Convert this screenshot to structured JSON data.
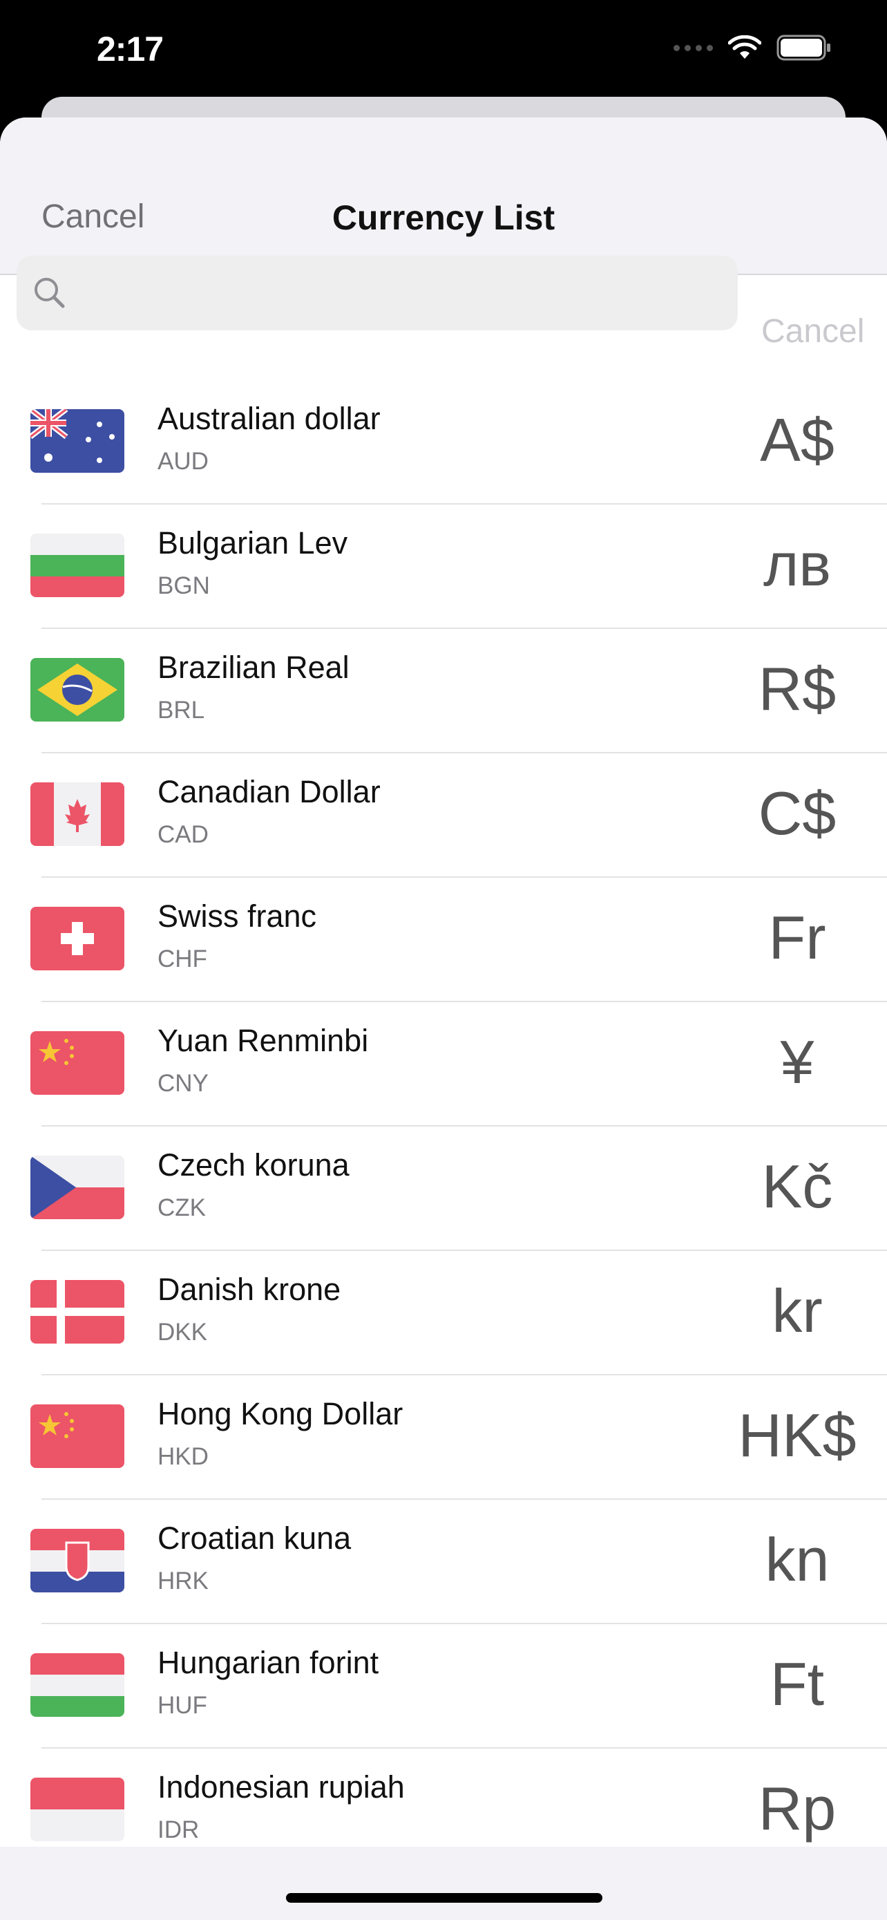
{
  "status_bar": {
    "time": "2:17"
  },
  "nav": {
    "cancel_label": "Cancel",
    "title": "Currency List"
  },
  "search": {
    "placeholder": "",
    "value": "",
    "cancel_label": "Cancel"
  },
  "currencies": [
    {
      "name": "Australian dollar",
      "code": "AUD",
      "symbol": "A$",
      "flag": "australia"
    },
    {
      "name": "Bulgarian Lev",
      "code": "BGN",
      "symbol": "лв",
      "flag": "bulgaria"
    },
    {
      "name": "Brazilian Real",
      "code": "BRL",
      "symbol": "R$",
      "flag": "brazil"
    },
    {
      "name": "Canadian Dollar",
      "code": "CAD",
      "symbol": "C$",
      "flag": "canada"
    },
    {
      "name": "Swiss franc",
      "code": "CHF",
      "symbol": "Fr",
      "flag": "switzerland"
    },
    {
      "name": "Yuan Renminbi",
      "code": "CNY",
      "symbol": "¥",
      "flag": "china"
    },
    {
      "name": "Czech koruna",
      "code": "CZK",
      "symbol": "Kč",
      "flag": "czech"
    },
    {
      "name": "Danish krone",
      "code": "DKK",
      "symbol": "kr",
      "flag": "denmark"
    },
    {
      "name": "Hong Kong Dollar",
      "code": "HKD",
      "symbol": "HK$",
      "flag": "china"
    },
    {
      "name": "Croatian kuna",
      "code": "HRK",
      "symbol": "kn",
      "flag": "croatia"
    },
    {
      "name": "Hungarian forint",
      "code": "HUF",
      "symbol": "Ft",
      "flag": "hungary"
    },
    {
      "name": "Indonesian rupiah",
      "code": "IDR",
      "symbol": "Rp",
      "flag": "indonesia"
    }
  ],
  "colors": {
    "flag_red": "#ec5467",
    "flag_blue": "#3d4fa3",
    "flag_green": "#4bb358"
  }
}
